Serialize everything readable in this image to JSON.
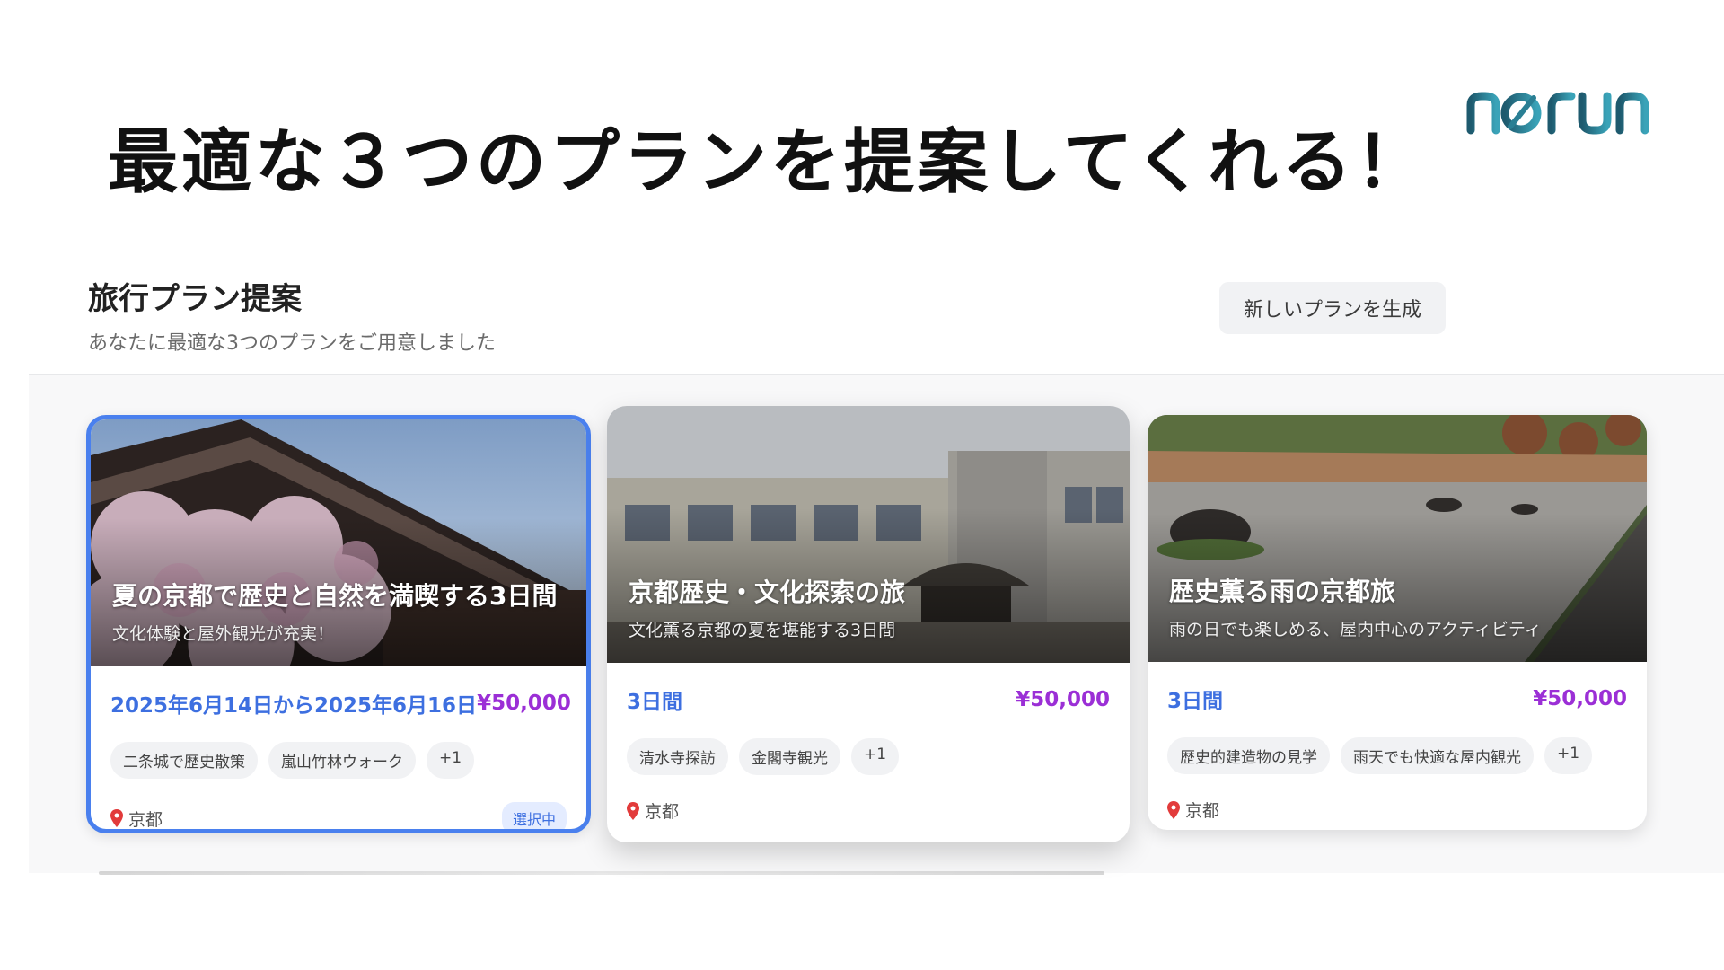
{
  "headline": "最適な３つのプランを提案してくれる！",
  "logo": {
    "text": "norun",
    "color_dark": "#1e5a6e",
    "color_light": "#3aa3b8"
  },
  "section": {
    "title": "旅行プラン提案",
    "subtitle": "あなたに最適な3つのプランをご用意しました",
    "new_plan_button": "新しいプランを生成"
  },
  "plans": [
    {
      "title": "夏の京都で歴史と自然を満喫する3日間",
      "subtitle": "文化体験と屋外観光が充実！",
      "duration": "2025年6月14日から2025年6月16日",
      "price": "¥50,000",
      "tags": [
        "二条城で歴史散策",
        "嵐山竹林ウォーク",
        "+1"
      ],
      "location": "京都",
      "badge": "選択中",
      "selected": true,
      "image": "temple-cherry-blossom"
    },
    {
      "title": "京都歴史・文化探索の旅",
      "subtitle": "文化薫る京都の夏を堪能する3日間",
      "duration": "3日間",
      "price": "¥50,000",
      "tags": [
        "清水寺探訪",
        "金閣寺観光",
        "+1"
      ],
      "location": "京都",
      "selected": false,
      "image": "old-school-building"
    },
    {
      "title": "歴史薫る雨の京都旅",
      "subtitle": "雨の日でも楽しめる、屋内中心のアクティビティ",
      "duration": "3日間",
      "price": "¥50,000",
      "tags": [
        "歴史的建造物の見学",
        "雨天でも快適な屋内観光",
        "+1"
      ],
      "location": "京都",
      "selected": false,
      "image": "rock-garden"
    }
  ],
  "colors": {
    "accent_blue": "#3d6fe0",
    "price_purple": "#9b2fd6",
    "selected_border": "#4a80ee"
  }
}
